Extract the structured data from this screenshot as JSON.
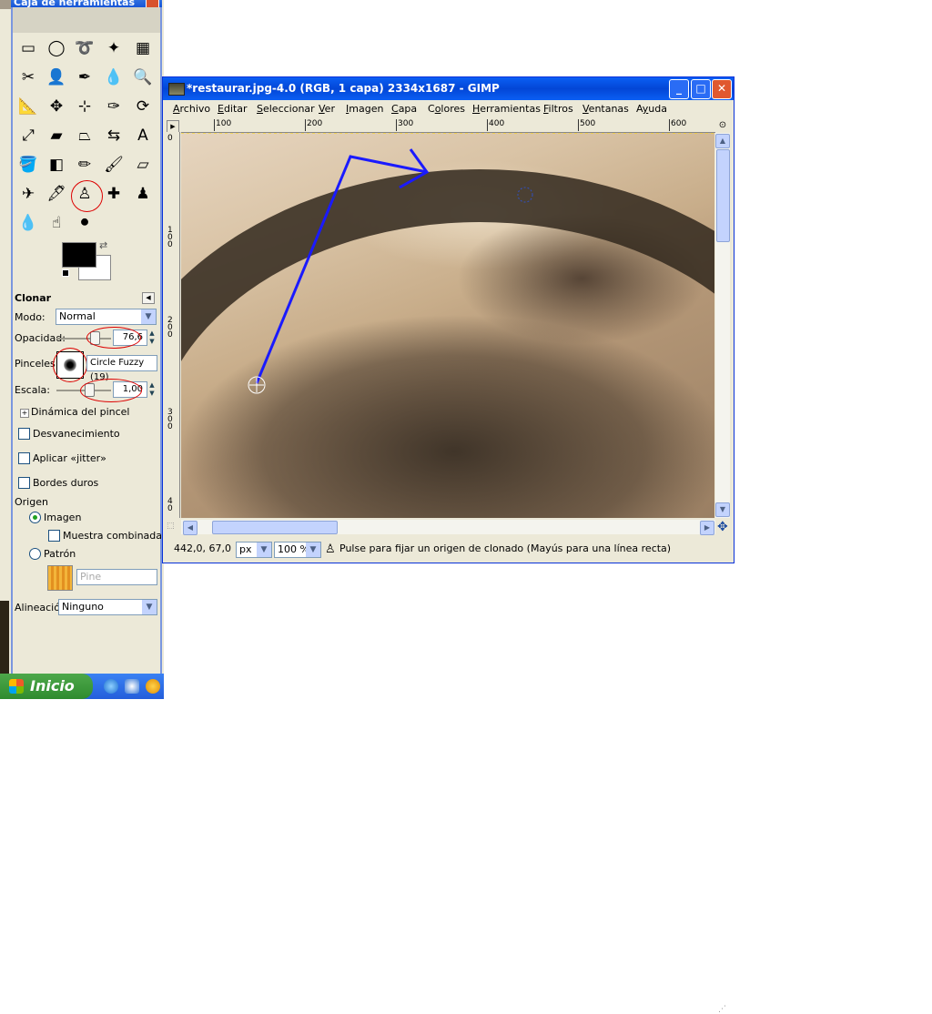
{
  "toolbox": {
    "title": "Caja de herramientas",
    "tools": [
      {
        "name": "rect-select-icon",
        "glyph": "▭"
      },
      {
        "name": "ellipse-select-icon",
        "glyph": "◯"
      },
      {
        "name": "lasso-icon",
        "glyph": "➰"
      },
      {
        "name": "fuzzy-select-icon",
        "glyph": "✦"
      },
      {
        "name": "select-by-color-icon",
        "glyph": "▦"
      },
      {
        "name": "scissors-icon",
        "glyph": "✂"
      },
      {
        "name": "foreground-select-icon",
        "glyph": "👤"
      },
      {
        "name": "paths-icon",
        "glyph": "✒"
      },
      {
        "name": "color-picker-icon",
        "glyph": "💧"
      },
      {
        "name": "zoom-icon",
        "glyph": "🔍"
      },
      {
        "name": "measure-icon",
        "glyph": "📐"
      },
      {
        "name": "move-icon",
        "glyph": "✥"
      },
      {
        "name": "align-icon",
        "glyph": "⊹"
      },
      {
        "name": "crop-icon",
        "glyph": "✑"
      },
      {
        "name": "rotate-icon",
        "glyph": "⟳"
      },
      {
        "name": "scale-icon",
        "glyph": "⤢"
      },
      {
        "name": "shear-icon",
        "glyph": "▰"
      },
      {
        "name": "perspective-icon",
        "glyph": "⏢"
      },
      {
        "name": "flip-icon",
        "glyph": "⇆"
      },
      {
        "name": "text-icon",
        "glyph": "A"
      },
      {
        "name": "bucket-fill-icon",
        "glyph": "🪣"
      },
      {
        "name": "gradient-icon",
        "glyph": "◧"
      },
      {
        "name": "pencil-icon",
        "glyph": "✏"
      },
      {
        "name": "paintbrush-icon",
        "glyph": "🖌"
      },
      {
        "name": "eraser-icon",
        "glyph": "▱"
      },
      {
        "name": "airbrush-icon",
        "glyph": "✈"
      },
      {
        "name": "ink-icon",
        "glyph": "🖋"
      },
      {
        "name": "clone-icon",
        "glyph": "♙"
      },
      {
        "name": "heal-icon",
        "glyph": "✚"
      },
      {
        "name": "perspective-clone-icon",
        "glyph": "♟"
      },
      {
        "name": "blur-icon",
        "glyph": "💧"
      },
      {
        "name": "smudge-icon",
        "glyph": "☝"
      },
      {
        "name": "dodge-burn-icon",
        "glyph": "⚫"
      }
    ],
    "foreground_color": "#000000",
    "background_color": "#ffffff",
    "options": {
      "title": "Clonar",
      "mode_label": "Modo:",
      "mode_value": "Normal",
      "opacity_label": "Opacidad:",
      "opacity_value": "76,6",
      "brush_label": "Pinceles:",
      "brush_value": "Circle Fuzzy (19)",
      "scale_label": "Escala:",
      "scale_value": "1,00",
      "brush_dynamics": "Dinámica del pincel",
      "fade": "Desvanecimiento",
      "jitter": "Aplicar «jitter»",
      "hard_edges": "Bordes duros",
      "source_label": "Origen",
      "source_image": "Imagen",
      "sample_merged": "Muestra combinada",
      "source_pattern": "Patrón",
      "pattern_name": "Pine",
      "alignment_label": "Alineación:",
      "alignment_value": "Ninguno"
    }
  },
  "taskbar": {
    "start_label": "Inicio"
  },
  "window": {
    "title": "*restaurar.jpg-4.0 (RGB, 1 capa) 2334x1687 - GIMP",
    "menu": [
      "Archivo",
      "Editar",
      "Seleccionar",
      "Ver",
      "Imagen",
      "Capa",
      "Colores",
      "Herramientas",
      "Filtros",
      "Ventanas",
      "Ayuda"
    ],
    "menu_mnemonics": [
      "A",
      "E",
      "S",
      "V",
      "I",
      "C",
      "o",
      "H",
      "F",
      "V",
      "y"
    ],
    "hruler_ticks": [
      "100",
      "200",
      "300",
      "400",
      "500",
      "600"
    ],
    "vruler_ticks": [
      "0",
      "1 0 0",
      "2 0 0",
      "3 0 0",
      "4 0"
    ],
    "status": {
      "coords": "442,0, 67,0",
      "unit": "px",
      "zoom": "100 %",
      "message": "Pulse para fijar un origen de clonado (Mayús para una línea recta)"
    }
  },
  "colors": {
    "annotation_line": "#1a1aff",
    "highlight_ring": "#dd0000",
    "titlebar": "#0a5ff4"
  }
}
